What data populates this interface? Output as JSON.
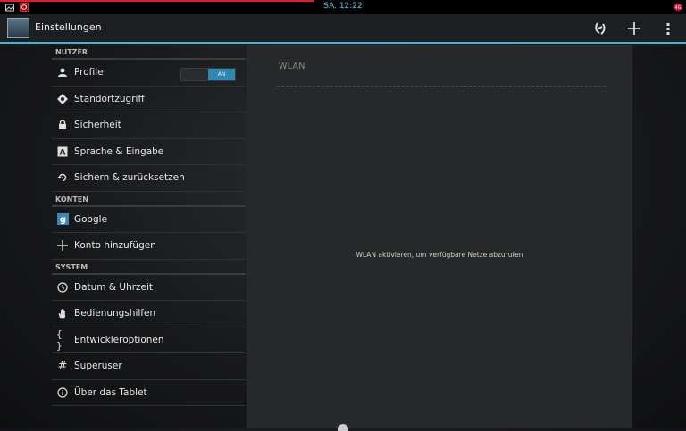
{
  "status": {
    "time": "SA. 12:22"
  },
  "actionbar": {
    "title": "Einstellungen"
  },
  "sections": [
    {
      "header": "NUTZER",
      "items": [
        {
          "label": "Profile",
          "icon": "profile-icon"
        },
        {
          "label": "Standortzugriff",
          "icon": "location-icon"
        },
        {
          "label": "Sicherheit",
          "icon": "lock-icon"
        },
        {
          "label": "Sprache & Eingabe",
          "icon": "keyboard-a-icon"
        },
        {
          "label": "Sichern & zurücksetzen",
          "icon": "backup-icon"
        }
      ]
    },
    {
      "header": "KONTEN",
      "items": [
        {
          "label": "Google",
          "icon": "google-icon"
        },
        {
          "label": "Konto hinzufügen",
          "icon": "plus-icon"
        }
      ]
    },
    {
      "header": "SYSTEM",
      "items": [
        {
          "label": "Datum & Uhrzeit",
          "icon": "clock-icon"
        },
        {
          "label": "Bedienungshilfen",
          "icon": "hand-icon"
        },
        {
          "label": "Entwickleroptionen",
          "icon": "braces-icon"
        },
        {
          "label": "Superuser",
          "icon": "hash-icon"
        },
        {
          "label": "Über das Tablet",
          "icon": "info-icon"
        }
      ]
    }
  ],
  "profile_toggle": {
    "state": "AN"
  },
  "detail": {
    "title": "WLAN",
    "message": "WLAN aktivieren, um verfügbare Netze abzurufen"
  },
  "colors": {
    "accent": "#33b5e5",
    "status_red": "#e0202c"
  }
}
